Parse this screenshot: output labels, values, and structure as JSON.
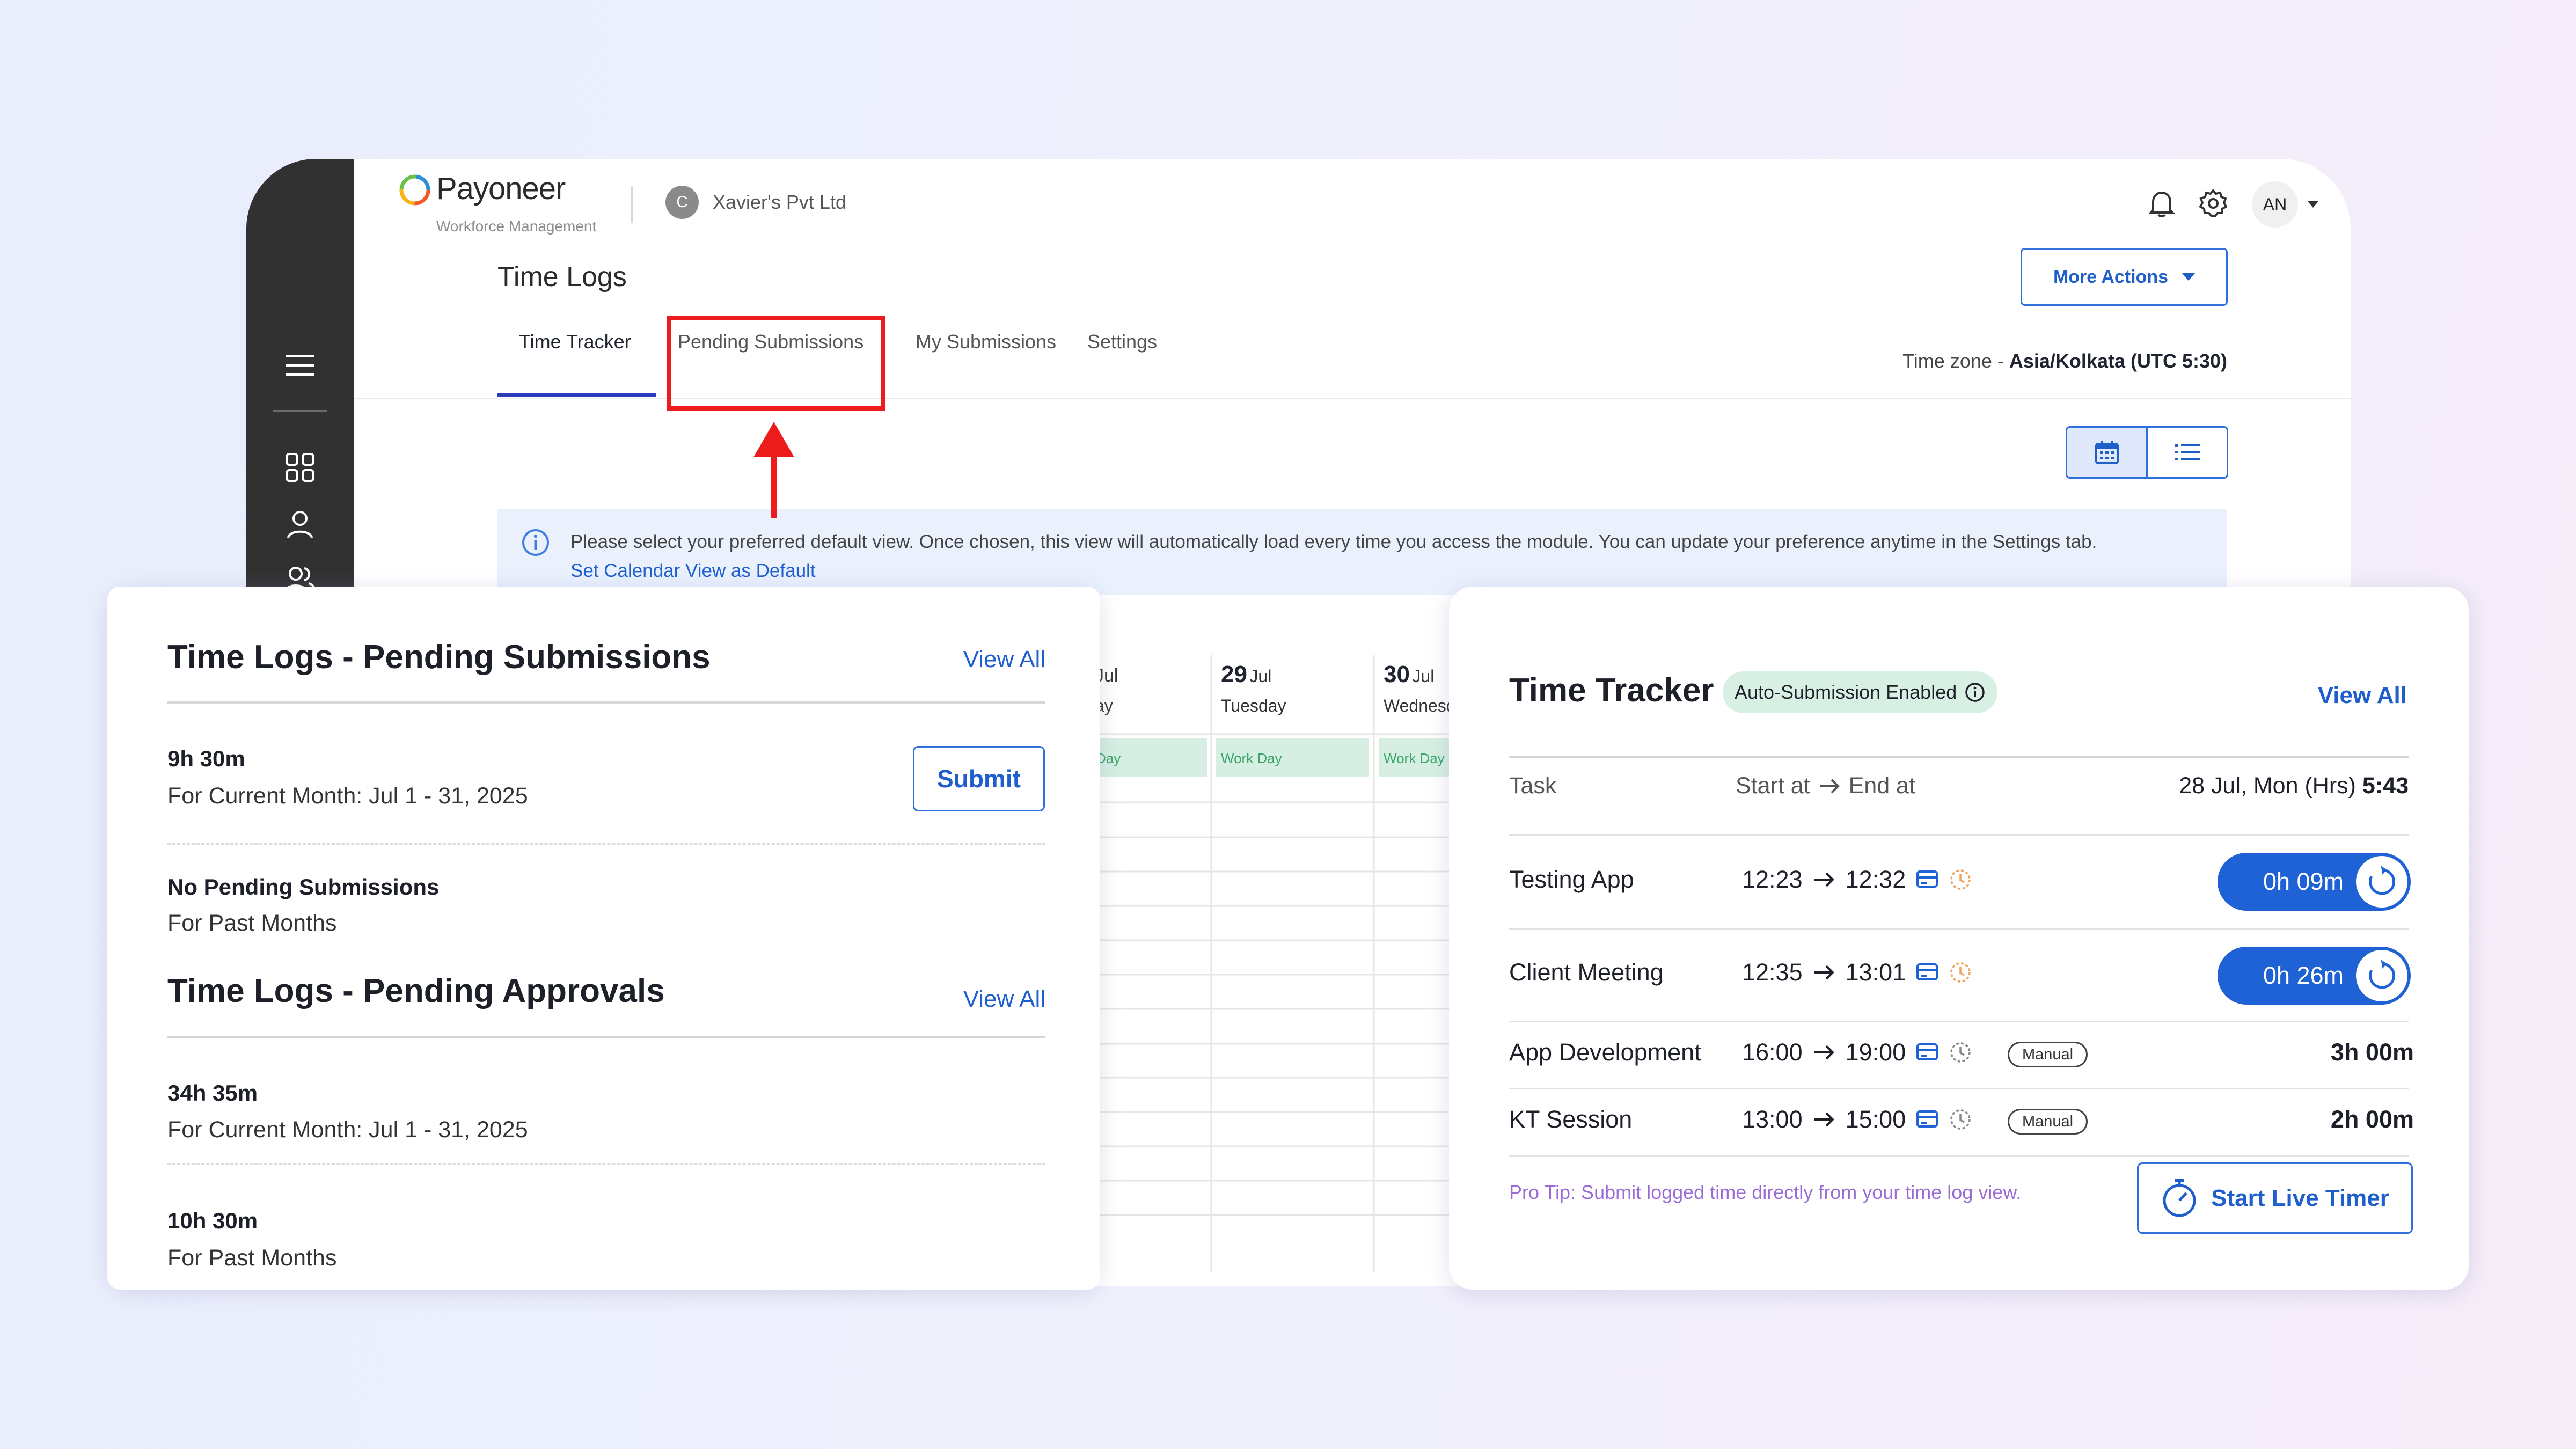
{
  "app": {
    "brand": "Payoneer",
    "brand_sub": "Workforce Management",
    "company_initial": "C",
    "company_name": "Xavier's Pvt Ltd",
    "user_initials": "AN",
    "page_title": "Time Logs",
    "more_actions": "More Actions",
    "tabs": [
      {
        "label": "Time Tracker",
        "selected": true
      },
      {
        "label": "Pending Submissions",
        "selected": false
      },
      {
        "label": "My Submissions",
        "selected": false
      },
      {
        "label": "Settings",
        "selected": false
      }
    ],
    "timezone_label": "Time zone - ",
    "timezone_value": "Asia/Kolkata (UTC 5:30)",
    "info_text": "Please select your preferred default view. Once chosen, this view will automatically load every time you access the module. You can update your preference anytime in the Settings tab.",
    "info_link": "Set Calendar View as Default",
    "sidebar_icons": [
      "menu-icon",
      "grid-icon",
      "user-icon",
      "users-icon",
      "clock-icon",
      "wallet-icon"
    ],
    "calendar": {
      "days": [
        {
          "num": "",
          "mon": "Jul",
          "dow": "ay",
          "tag": "Day"
        },
        {
          "num": "29",
          "mon": "Jul",
          "dow": "Tuesday",
          "tag": "Work Day"
        },
        {
          "num": "30",
          "mon": "Jul",
          "dow": "Wednesd",
          "tag": "Work Day"
        }
      ]
    },
    "accent_color": "#1f62d6",
    "highlight_color": "#ec1c1c"
  },
  "pending_card": {
    "title": "Time Logs - Pending Submissions",
    "view_all": "View All",
    "items": [
      {
        "value": "9h 30m",
        "label": "For Current Month: Jul 1 - 31, 2025"
      },
      {
        "value": "No Pending Submissions",
        "label": "For Past Months"
      }
    ],
    "submit": "Submit",
    "approvals_title": "Time Logs - Pending Approvals",
    "approvals_view_all": "View All",
    "approvals": [
      {
        "value": "34h 35m",
        "label": "For Current Month: Jul 1 - 31, 2025"
      },
      {
        "value": "10h 30m",
        "label": "For Past Months"
      }
    ]
  },
  "tracker_card": {
    "title": "Time Tracker",
    "badge": "Auto-Submission Enabled",
    "view_all": "View All",
    "col_task": "Task",
    "col_start": "Start at",
    "col_end": "End at",
    "col_date": "28 Jul, Mon (Hrs)",
    "col_total": "5:43",
    "rows": [
      {
        "task": "Testing App",
        "start": "12:23",
        "end": "12:32",
        "timer": "0h 09m",
        "manual": ""
      },
      {
        "task": "Client Meeting",
        "start": "12:35",
        "end": "13:01",
        "timer": "0h 26m",
        "manual": ""
      },
      {
        "task": "App Development",
        "start": "16:00",
        "end": "19:00",
        "hours": "3h",
        "mins": "00m",
        "manual": "Manual"
      },
      {
        "task": "KT Session",
        "start": "13:00",
        "end": "15:00",
        "hours": "2h",
        "mins": "00m",
        "manual": "Manual"
      }
    ],
    "pro_tip": "Pro Tip: Submit logged time directly from your time log view.",
    "start_live_timer": "Start Live Timer"
  }
}
